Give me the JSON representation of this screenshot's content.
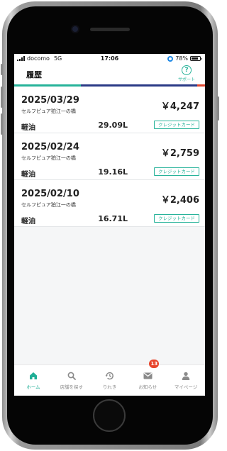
{
  "status_bar": {
    "carrier": "docomo",
    "network": "5G",
    "time": "17:06",
    "battery": "78%"
  },
  "header": {
    "title": "履歴",
    "support_label": "サポート",
    "support_icon_glyph": "?"
  },
  "colors": {
    "accent_green": "#27b39a",
    "accent_navy": "#2b3a86",
    "accent_red": "#e0462f",
    "badge_red": "#e8452c"
  },
  "history": [
    {
      "date": "2025/03/29",
      "station": "セルフピュア狛江一の橋",
      "price": "￥4,247",
      "fuel": "軽油",
      "volume": "29.09L",
      "payment": "クレジットカード"
    },
    {
      "date": "2025/02/24",
      "station": "セルフピュア狛江一の橋",
      "price": "￥2,759",
      "fuel": "軽油",
      "volume": "19.16L",
      "payment": "クレジットカード"
    },
    {
      "date": "2025/02/10",
      "station": "セルフピュア狛江一の橋",
      "price": "￥2,406",
      "fuel": "軽油",
      "volume": "16.71L",
      "payment": "クレジットカード"
    }
  ],
  "tabs": [
    {
      "label": "ホーム",
      "icon": "home-icon",
      "active": true
    },
    {
      "label": "店舗を探す",
      "icon": "search-icon",
      "active": false
    },
    {
      "label": "りれき",
      "icon": "history-icon",
      "active": false
    },
    {
      "label": "お知らせ",
      "icon": "mail-icon",
      "active": false,
      "badge": "13"
    },
    {
      "label": "マイページ",
      "icon": "person-icon",
      "active": false
    }
  ]
}
